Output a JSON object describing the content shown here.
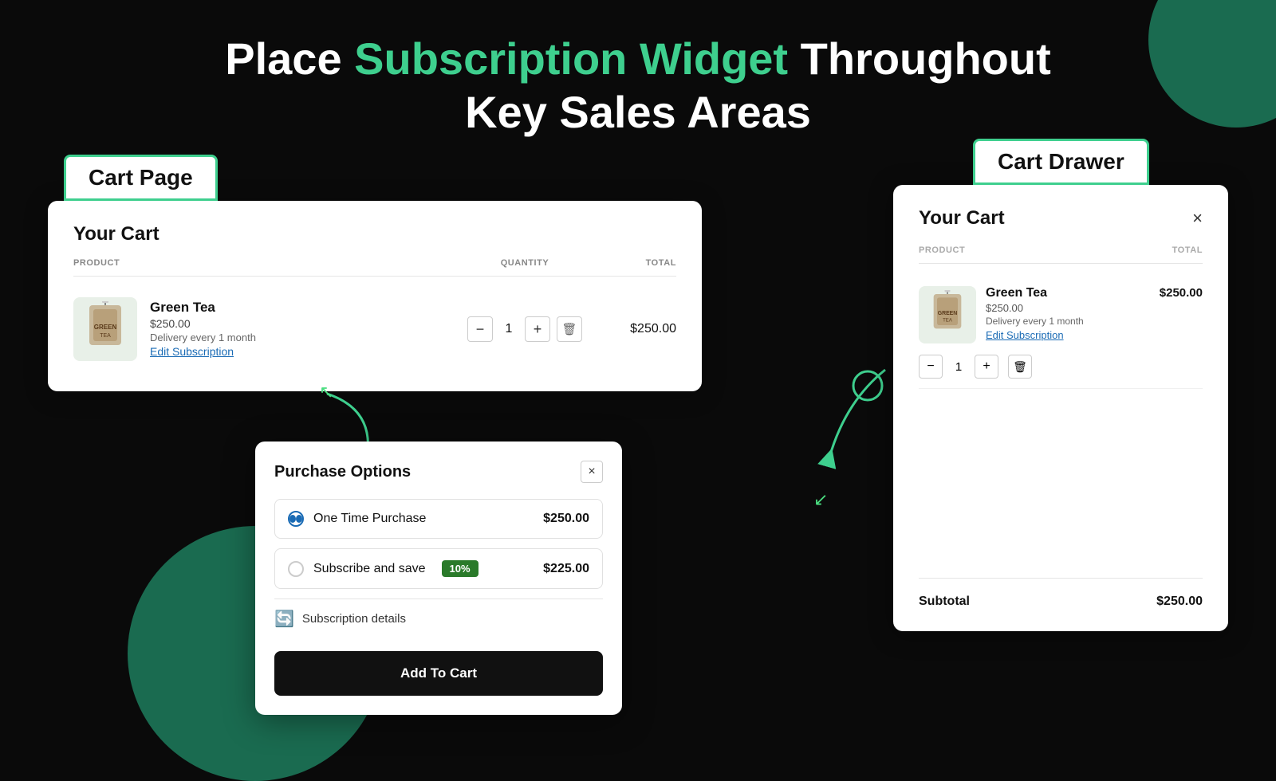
{
  "page": {
    "background": "#0a0a0a",
    "title_prefix": "Place ",
    "title_highlight": "Subscription Widget",
    "title_suffix": " Throughout",
    "title_line2": "Key Sales Areas"
  },
  "cart_page_label": "Cart Page",
  "cart_drawer_label": "Cart Drawer",
  "cart_page": {
    "title": "Your Cart",
    "columns": {
      "product": "PRODUCT",
      "quantity": "QUANTITY",
      "total": "TOTAL"
    },
    "item": {
      "name": "Green Tea",
      "price": "$250.00",
      "delivery": "Delivery every 1 month",
      "edit_link": "Edit Subscription",
      "quantity": "1",
      "item_total": "$250.00"
    }
  },
  "purchase_options": {
    "title": "Purchase Options",
    "close_label": "×",
    "options": [
      {
        "label": "One Time Purchase",
        "price": "$250.00",
        "selected": true,
        "badge": null
      },
      {
        "label": "Subscribe and save",
        "price": "$225.00",
        "selected": false,
        "badge": "10%"
      }
    ],
    "subscription_details_label": "Subscription details",
    "add_to_cart_label": "Add To Cart"
  },
  "cart_drawer": {
    "title": "Your Cart",
    "close_label": "×",
    "columns": {
      "product": "PRODUCT",
      "total": "TOTAL"
    },
    "item": {
      "name": "Green Tea",
      "price": "$250.00",
      "item_total": "$250.00",
      "delivery": "Delivery every 1 month",
      "edit_link": "Edit Subscription",
      "quantity": "1"
    },
    "subtotal_label": "Subtotal",
    "subtotal_value": "$250.00"
  },
  "icons": {
    "minus": "−",
    "plus": "+",
    "trash": "🗑",
    "close": "×",
    "subscription_details": "🔄"
  }
}
